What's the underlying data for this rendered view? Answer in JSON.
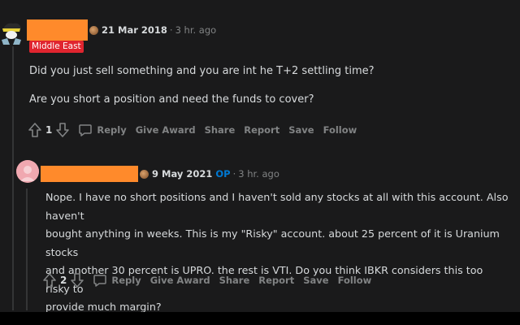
{
  "comment1": {
    "date": "21 Mar 2018",
    "separator": "·",
    "time": "3 hr. ago",
    "flair": "Middle East",
    "paragraphs": [
      "Did you just sell something and you are int he T+2 settling time?",
      "Are you short a position and need the funds to cover?"
    ],
    "score": "1",
    "actions": {
      "reply": "Reply",
      "give_award": "Give Award",
      "share": "Share",
      "report": "Report",
      "save": "Save",
      "follow": "Follow"
    }
  },
  "comment2": {
    "date": "9 May 2021",
    "op_badge": "OP",
    "separator": "·",
    "time": "3 hr. ago",
    "paragraph_lines": [
      "Nope. I have no short positions and I haven't sold any stocks at all with this account. Also haven't",
      "bought anything in weeks. This is my \"Risky\" account. about 25 percent of it is Uranium stocks",
      "and another 30 percent is UPRO. the rest is VTI. Do you think IBKR considers this too risky to",
      "provide much margin?"
    ],
    "score": "2",
    "actions": {
      "reply": "Reply",
      "give_award": "Give Award",
      "share": "Share",
      "report": "Report",
      "save": "Save",
      "follow": "Follow"
    }
  },
  "colors": {
    "background": "#1a1a1b",
    "text": "#d7dadc",
    "muted": "#818384",
    "op": "#0079d3",
    "flair_bg": "#e0252f",
    "redaction": "#ff8a2b"
  },
  "icons": [
    "award-icon",
    "upvote-icon",
    "downvote-icon",
    "comment-icon"
  ]
}
